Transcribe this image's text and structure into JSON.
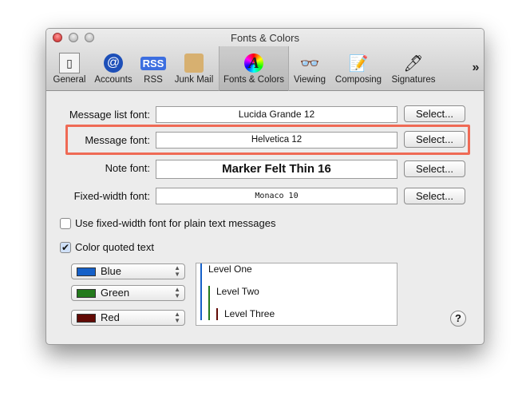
{
  "window": {
    "title": "Fonts & Colors"
  },
  "toolbar": {
    "items": [
      {
        "label": "General",
        "icon": "switch-icon"
      },
      {
        "label": "Accounts",
        "icon": "at-icon"
      },
      {
        "label": "RSS",
        "icon": "rss-icon"
      },
      {
        "label": "Junk Mail",
        "icon": "junk-mail-icon"
      },
      {
        "label": "Fonts & Colors",
        "icon": "color-font-icon",
        "selected": true
      },
      {
        "label": "Viewing",
        "icon": "glasses-icon"
      },
      {
        "label": "Composing",
        "icon": "pencil-pad-icon"
      },
      {
        "label": "Signatures",
        "icon": "pen-icon"
      }
    ],
    "overflow": "»"
  },
  "fonts": [
    {
      "label": "Message list font:",
      "value": "Lucida Grande 12",
      "button": "Select..."
    },
    {
      "label": "Message font:",
      "value": "Helvetica 12",
      "button": "Select...",
      "highlighted": true
    },
    {
      "label": "Note font:",
      "value": "Marker Felt Thin 16",
      "button": "Select..."
    },
    {
      "label": "Fixed-width font:",
      "value": "Monaco 10",
      "button": "Select..."
    }
  ],
  "options": {
    "fixed_width": {
      "label": "Use fixed-width font for plain text messages",
      "checked": false
    },
    "color_quoted": {
      "label": "Color quoted text",
      "checked": true
    }
  },
  "levels": [
    {
      "color_name": "Blue",
      "color": "#1560c8",
      "preview": "Level One"
    },
    {
      "color_name": "Green",
      "color": "#237a1c",
      "preview": "Level Two"
    },
    {
      "color_name": "Red",
      "color": "#620a05",
      "preview": "Level Three"
    }
  ],
  "help": "?",
  "highlight_color": "#ef6a55"
}
